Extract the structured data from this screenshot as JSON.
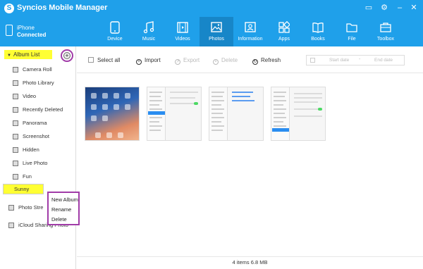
{
  "app": {
    "title": "Syncios Mobile Manager"
  },
  "device": {
    "name": "iPhone",
    "status": "Connected"
  },
  "nav": {
    "tabs": [
      {
        "label": "Device"
      },
      {
        "label": "Music"
      },
      {
        "label": "Videos"
      },
      {
        "label": "Photos"
      },
      {
        "label": "Information"
      },
      {
        "label": "Apps"
      },
      {
        "label": "Books"
      },
      {
        "label": "File"
      },
      {
        "label": "Toolbox"
      }
    ],
    "active": "Photos"
  },
  "sidebar": {
    "header": "Album List",
    "items": [
      {
        "label": "Camera Roll"
      },
      {
        "label": "Photo Library"
      },
      {
        "label": "Video"
      },
      {
        "label": "Recently Deleted"
      },
      {
        "label": "Panorama"
      },
      {
        "label": "Screenshot"
      },
      {
        "label": "Hidden"
      },
      {
        "label": "Live Photo"
      },
      {
        "label": "Fun"
      }
    ],
    "selected": "Sunny",
    "after_items": [
      {
        "label": "Photo Stre"
      },
      {
        "label": "iCloud Sharing Photo"
      }
    ]
  },
  "context_menu": {
    "items": [
      "New Album",
      "Rename",
      "Delete"
    ]
  },
  "toolbar": {
    "select_all": "Select all",
    "import": "Import",
    "export": "Export",
    "delete": "Delete",
    "refresh": "Refresh",
    "start_date": "Start date",
    "end_date": "End date",
    "date_sep": "-"
  },
  "status": {
    "summary": "4 items 6.8 MB"
  },
  "colors": {
    "accent": "#1fa0ea",
    "highlight": "#ffff33",
    "annotation": "#a13ca8"
  }
}
